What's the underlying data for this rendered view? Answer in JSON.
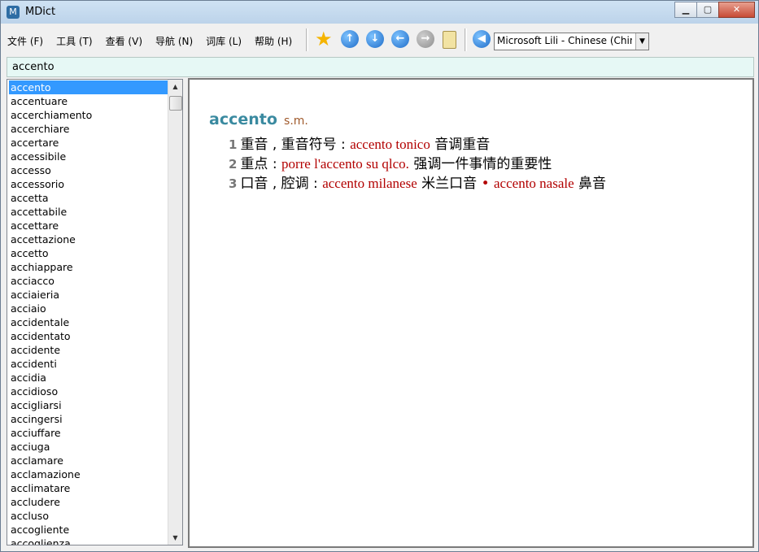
{
  "window": {
    "title": "MDict"
  },
  "menu": [
    {
      "label": "文件 (F)"
    },
    {
      "label": "工具 (T)"
    },
    {
      "label": "查看 (V)"
    },
    {
      "label": "导航 (N)"
    },
    {
      "label": "词库 (L)"
    },
    {
      "label": "帮助 (H)"
    }
  ],
  "toolbar": {
    "voice_value": "Microsoft Lili - Chinese (China)",
    "icons": [
      "favorite-star-icon",
      "up-arrow-icon",
      "down-arrow-icon",
      "back-arrow-icon",
      "forward-arrow-icon",
      "clipboard-icon",
      "speaker-icon"
    ]
  },
  "search": {
    "value": "accento"
  },
  "wordlist": {
    "items": [
      "accento",
      "accentuare",
      "accerchiamento",
      "accerchiare",
      "accertare",
      "accessibile",
      "accesso",
      "accessorio",
      "accetta",
      "accettabile",
      "accettare",
      "accettazione",
      "accetto",
      "acchiappare",
      "acciacco",
      "acciaieria",
      "acciaio",
      "accidentale",
      "accidentato",
      "accidente",
      "accidenti",
      "accidia",
      "accidioso",
      "accigliarsi",
      "accingersi",
      "acciuffare",
      "acciuga",
      "acclamare",
      "acclamazione",
      "acclimatare",
      "accludere",
      "accluso",
      "accogliente",
      "accoglienza"
    ],
    "selected": "accento"
  },
  "entry": {
    "headword": "accento",
    "pos": "s.m.",
    "senses": [
      {
        "num": "1",
        "def": "重音 , 重音符号 : ",
        "ex1": "accento tonico",
        "tr1": " 音调重音",
        "ex2": "",
        "tr2": ""
      },
      {
        "num": "2",
        "def": "重点 : ",
        "ex1": "porre l'accento su qlco.",
        "tr1": " 强调一件事情的重要性",
        "ex2": "",
        "tr2": ""
      },
      {
        "num": "3",
        "def": "口音 , 腔调 : ",
        "ex1": "accento milanese",
        "tr1": " 米兰口音",
        "ex2": "accento nasale",
        "tr2": " 鼻音"
      }
    ]
  },
  "colors": {
    "selection": "#3399ff",
    "headword": "#3a8aa0",
    "example": "#b20000",
    "search_bg": "#e6f8f5"
  }
}
